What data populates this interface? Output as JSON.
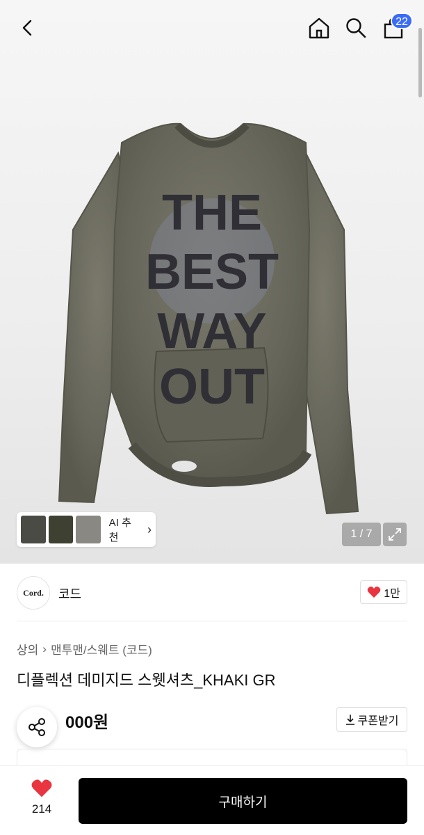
{
  "header": {
    "back_icon": "chevron-left-icon",
    "home_icon": "home-icon",
    "search_icon": "search-icon",
    "cart_icon": "shopping-bag-icon",
    "cart_count": "22"
  },
  "gallery": {
    "ai_recommend_label": "AI 추천",
    "counter": "1 / 7",
    "expand_icon": "expand-icon",
    "print_text": [
      "THE",
      "BEST",
      "WAY",
      "OUT"
    ]
  },
  "brand": {
    "logo_text": "Cord.",
    "name": "코드",
    "like_label": "1만"
  },
  "product": {
    "breadcrumb_category": "상의",
    "breadcrumb_sub": "맨투맨/스웨트 (코드)",
    "title": "디플렉션 데미지드 스웻셔츠_KHAKI GR",
    "price": "000원",
    "coupon_label": "쿠폰받기"
  },
  "bottom": {
    "like_count": "214",
    "buy_label": "구매하기"
  },
  "colors": {
    "accent_red": "#e8353f",
    "badge_blue": "#3b6cf6",
    "buy_button": "#000000",
    "garment_khaki": "#6b6a5e"
  }
}
